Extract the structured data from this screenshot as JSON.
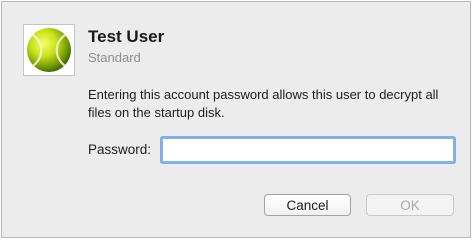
{
  "dialog": {
    "avatar_icon": "tennis-ball-icon",
    "user_name": "Test User",
    "user_type": "Standard",
    "message": "Entering this account password allows this user to decrypt all files on the startup disk.",
    "password_label": "Password:",
    "password_value": "",
    "buttons": {
      "cancel_label": "Cancel",
      "ok_label": "OK"
    }
  },
  "colors": {
    "dialog_background": "#ececec",
    "focus_ring": "#7eb0ee",
    "disabled_text": "#a9a9a9"
  }
}
